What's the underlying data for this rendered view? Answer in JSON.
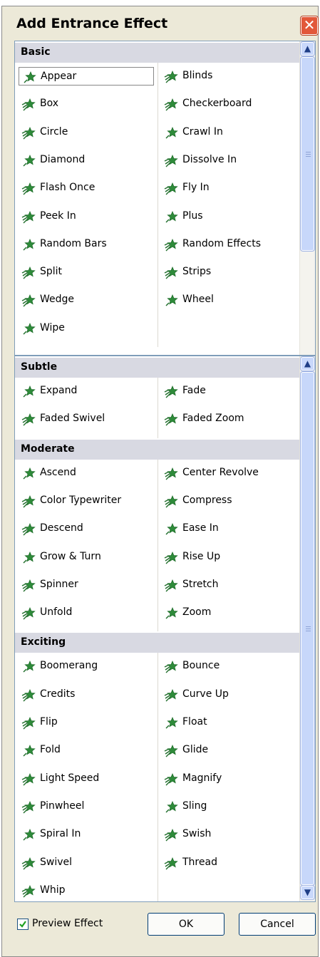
{
  "dialog": {
    "title": "Add Entrance Effect",
    "close_glyph": "✕"
  },
  "sections": [
    {
      "name": "Basic",
      "left": [
        "Appear",
        "Box",
        "Circle",
        "Diamond",
        "Flash Once",
        "Peek In",
        "Random Bars",
        "Split",
        "Wedge",
        "Wipe"
      ],
      "right": [
        "Blinds",
        "Checkerboard",
        "Crawl In",
        "Dissolve In",
        "Fly In",
        "Plus",
        "Random Effects",
        "Strips",
        "Wheel"
      ]
    },
    {
      "name": "Subtle",
      "left": [
        "Expand",
        "Faded Swivel"
      ],
      "right": [
        "Fade",
        "Faded Zoom"
      ]
    },
    {
      "name": "Moderate",
      "left": [
        "Ascend",
        "Color Typewriter",
        "Descend",
        "Grow & Turn",
        "Spinner",
        "Unfold"
      ],
      "right": [
        "Center Revolve",
        "Compress",
        "Ease In",
        "Rise Up",
        "Stretch",
        "Zoom"
      ]
    },
    {
      "name": "Exciting",
      "left": [
        "Boomerang",
        "Credits",
        "Flip",
        "Fold",
        "Light Speed",
        "Pinwheel",
        "Spiral In",
        "Swivel",
        "Whip"
      ],
      "right": [
        "Bounce",
        "Curve Up",
        "Float",
        "Glide",
        "Magnify",
        "Sling",
        "Swish",
        "Thread"
      ]
    }
  ],
  "selected_effect": "Appear",
  "footer": {
    "preview_label": "Preview Effect",
    "preview_checked": true,
    "ok_label": "OK",
    "cancel_label": "Cancel"
  },
  "colors": {
    "star_green": "#2e8b3a",
    "star_dark": "#1f6d2a",
    "selection_border": "#888888",
    "header_bg": "#d8d9e2"
  }
}
